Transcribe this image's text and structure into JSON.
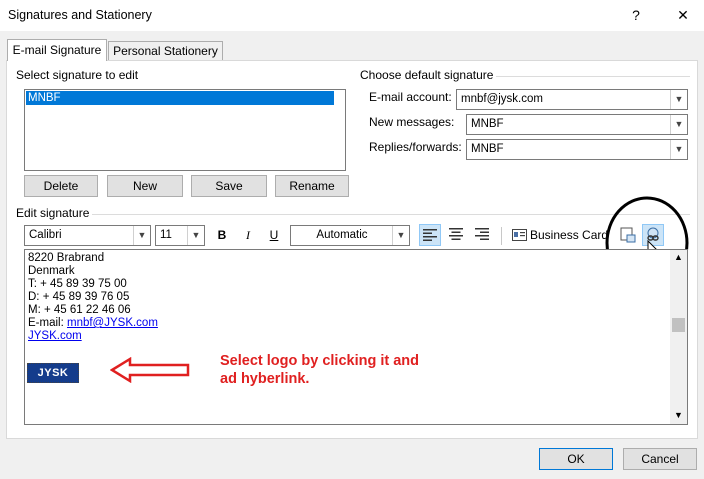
{
  "window": {
    "title": "Signatures and Stationery",
    "help_glyph": "?",
    "close_glyph": "✕"
  },
  "tabs": [
    {
      "label": "E-mail Signature",
      "active": true
    },
    {
      "label": "Personal Stationery",
      "active": false
    }
  ],
  "select_signature": {
    "label": "Select signature to edit",
    "items": [
      "MNBF"
    ],
    "selected": "MNBF"
  },
  "signature_buttons": {
    "delete": "Delete",
    "new": "New",
    "save": "Save",
    "rename": "Rename"
  },
  "default_signature": {
    "group_label": "Choose default signature",
    "email_account_label": "E-mail account:",
    "email_account_value": "mnbf@jysk.com",
    "new_messages_label": "New messages:",
    "new_messages_value": "MNBF",
    "replies_label": "Replies/forwards:",
    "replies_value": "MNBF"
  },
  "edit_signature": {
    "label": "Edit signature",
    "font": "Calibri",
    "size": "11",
    "bold": "B",
    "italic": "I",
    "underline": "U",
    "color": "Automatic",
    "business_card": "Business Card"
  },
  "signature_body": {
    "lines": [
      "8220 Brabrand",
      "Denmark",
      "T: + 45 89 39 75 00",
      "D: + 45 89 39 76 05",
      "M: + 45 61 22 46 06"
    ],
    "email_prefix": "E-mail: ",
    "email_link": "mnbf@JYSK.com",
    "web_link": "JYSK.com",
    "logo_text": "JYSK"
  },
  "annotation": {
    "line1": "Select logo by clicking it and",
    "line2": "ad hyberlink.",
    "color": "#e02020"
  },
  "footer": {
    "ok": "OK",
    "cancel": "Cancel"
  },
  "colors": {
    "selection": "#0078d7",
    "link": "#0000ee",
    "annotation": "#e02020"
  }
}
